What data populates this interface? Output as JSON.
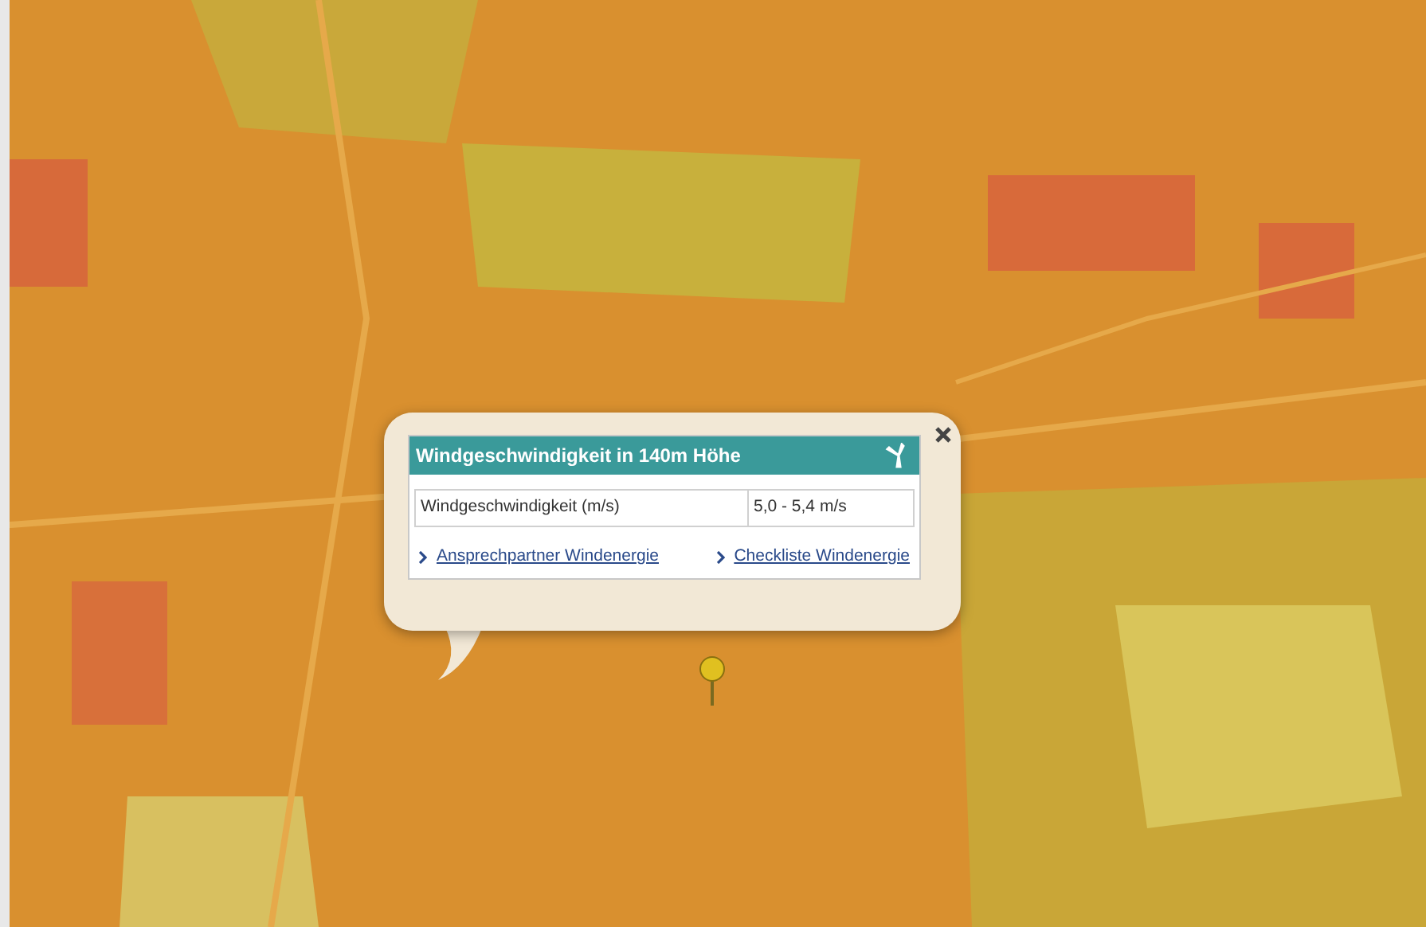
{
  "popup": {
    "title": "Windgeschwindigkeit in 140m Höhe",
    "rows": [
      {
        "label": "Windgeschwindigkeit (m/s)",
        "value": "5,0 - 5,4 m/s"
      }
    ],
    "links": [
      "Ansprechpartner Windenergie",
      "Checkliste Windenergie"
    ]
  }
}
